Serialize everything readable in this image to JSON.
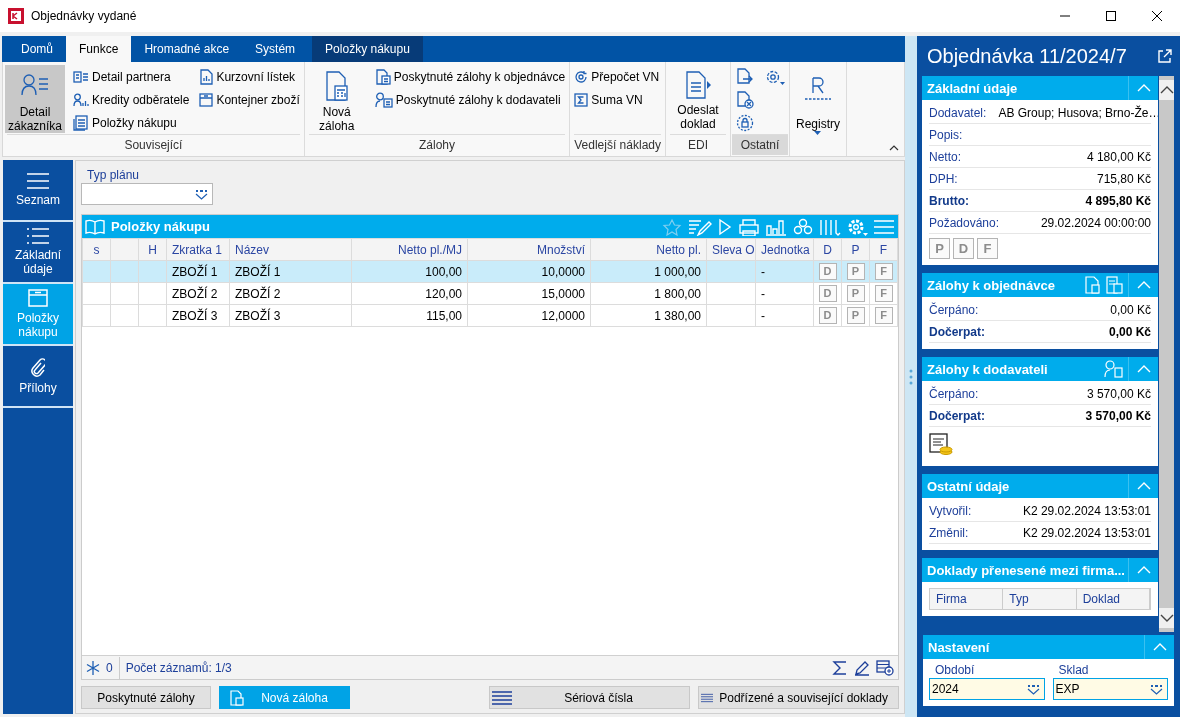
{
  "window": {
    "title": "Objednávky vydané"
  },
  "ribbon": {
    "tabs": [
      {
        "label": "Domů",
        "selected": false,
        "kind": "normal"
      },
      {
        "label": "Funkce",
        "selected": true,
        "kind": "normal"
      },
      {
        "label": "Hromadné akce",
        "selected": false,
        "kind": "normal"
      },
      {
        "label": "Systém",
        "selected": false,
        "kind": "normal"
      },
      {
        "label": "Položky nákupu",
        "selected": false,
        "kind": "contextual"
      }
    ],
    "groups": [
      {
        "label": "Související",
        "highlighted": false,
        "items": [
          {
            "kind": "large",
            "label": "Detail zákazníka",
            "selected": true
          },
          {
            "kind": "small",
            "label": "Detail partnera",
            "selected": false
          },
          {
            "kind": "small",
            "label": "Kredity odběratele",
            "selected": false
          },
          {
            "kind": "small",
            "label": "Položky nákupu",
            "selected": false
          },
          {
            "kind": "small",
            "label": "Kurzovní lístek",
            "selected": false
          },
          {
            "kind": "small",
            "label": "Kontejner zboží",
            "selected": false
          }
        ]
      },
      {
        "label": "Zálohy",
        "highlighted": false,
        "items": [
          {
            "kind": "large",
            "label": "Nová záloha",
            "selected": false
          },
          {
            "kind": "small",
            "label": "Poskytnuté zálohy k objednávce",
            "selected": false
          },
          {
            "kind": "small",
            "label": "Poskytnuté zálohy k dodavateli",
            "selected": false
          }
        ]
      },
      {
        "label": "Vedlejší náklady",
        "highlighted": false,
        "items": [
          {
            "kind": "small",
            "label": "Přepočet VN",
            "selected": false
          },
          {
            "kind": "small",
            "label": "Suma VN",
            "selected": false
          }
        ]
      },
      {
        "label": "EDI",
        "highlighted": false,
        "items": [
          {
            "kind": "large",
            "label": "Odeslat doklad",
            "selected": false
          }
        ]
      },
      {
        "label": "Ostatní",
        "highlighted": true,
        "items": [
          {
            "kind": "icon",
            "selected": false
          },
          {
            "kind": "icon",
            "selected": false
          },
          {
            "kind": "icon",
            "selected": false
          },
          {
            "kind": "icon",
            "selected": false
          }
        ]
      },
      {
        "highlighted": false,
        "items": [
          {
            "kind": "menu",
            "label": "Registry",
            "selected": false
          }
        ]
      }
    ]
  },
  "nav": [
    {
      "label": "Seznam",
      "selected": false
    },
    {
      "label": "Základní údaje",
      "selected": false
    },
    {
      "label": "Položky nákupu",
      "selected": true
    },
    {
      "label": "Přílohy",
      "selected": false
    }
  ],
  "filter": {
    "label": "Typ plánu"
  },
  "grid": {
    "title": "Položky nákupu",
    "columns": [
      {
        "label": "s",
        "kind": "center"
      },
      {
        "kind": "text"
      },
      {
        "label": "H",
        "kind": "center"
      },
      {
        "label": "Zkratka 1",
        "kind": "text"
      },
      {
        "label": "Název",
        "kind": "text"
      },
      {
        "label": "Netto pl./MJ",
        "kind": "number"
      },
      {
        "label": "Množství",
        "kind": "number"
      },
      {
        "label": "Netto pl.",
        "kind": "number"
      },
      {
        "label": "Sleva O",
        "kind": "text"
      },
      {
        "label": "Jednotka",
        "kind": "text"
      },
      {
        "label": "D",
        "kind": "flag"
      },
      {
        "label": "P",
        "kind": "flag"
      },
      {
        "label": "F",
        "kind": "flag"
      }
    ],
    "rows": [
      {
        "selected": true,
        "cells": [
          null,
          null,
          null,
          "ZBOŽÍ 1",
          "ZBOŽÍ 1",
          "100,00",
          "10,0000",
          "1 000,00",
          null,
          "-",
          "D",
          "P",
          "F"
        ]
      },
      {
        "selected": false,
        "cells": [
          null,
          null,
          null,
          "ZBOŽÍ 2",
          "ZBOŽÍ 2",
          "120,00",
          "15,0000",
          "1 800,00",
          null,
          "-",
          "D",
          "P",
          "F"
        ]
      },
      {
        "selected": false,
        "cells": [
          null,
          null,
          null,
          "ZBOŽÍ 3",
          "ZBOŽÍ 3",
          "115,00",
          "12,0000",
          "1 380,00",
          null,
          "-",
          "D",
          "P",
          "F"
        ]
      }
    ],
    "footer": {
      "filter_count": "0",
      "record_count": "Počet záznamů: 1/3"
    }
  },
  "actions": {
    "left": [
      {
        "label": "Poskytnuté zálohy",
        "kind": "plain"
      },
      {
        "label": "Nová záloha",
        "kind": "primary"
      }
    ],
    "right": [
      {
        "label": "Sériová čísla",
        "kind": "list"
      },
      {
        "label": "Podřízené a související doklady",
        "kind": "list"
      }
    ]
  },
  "detail": {
    "title": "Objednávka 11/2024/7",
    "sections": [
      {
        "kind": "fields",
        "title": "Základní údaje",
        "expanded": true,
        "rows": [
          {
            "label": "Dodavatel:",
            "value": "AB Group; Husova; Brno-Že…",
            "bold": false,
            "kind": "inline"
          },
          {
            "label": "Popis:",
            "bold": false,
            "kind": "inline"
          },
          {
            "label": "Netto:",
            "value": "4 180,00 Kč",
            "bold": false,
            "kind": "amount"
          },
          {
            "label": "DPH:",
            "value": "715,80 Kč",
            "bold": false,
            "kind": "amount"
          },
          {
            "label": "Brutto:",
            "value": "4 895,80 Kč",
            "bold": true,
            "kind": "amount"
          },
          {
            "label": "Požadováno:",
            "value": "29.02.2024 00:00:00",
            "bold": false,
            "kind": "amount"
          }
        ],
        "flags": [
          "P",
          "D",
          "F"
        ]
      },
      {
        "kind": "fields",
        "title": "Zálohy k objednávce",
        "expanded": true,
        "rows": [
          {
            "label": "Čerpáno:",
            "value": "0,00 Kč",
            "bold": false,
            "kind": "amount"
          },
          {
            "label": "Dočerpat:",
            "value": "0,00 Kč",
            "bold": true,
            "kind": "amount"
          }
        ]
      },
      {
        "kind": "fields",
        "title": "Zálohy k dodavateli",
        "expanded": true,
        "rows": [
          {
            "label": "Čerpáno:",
            "value": "3 570,00 Kč",
            "bold": false,
            "kind": "amount"
          },
          {
            "label": "Dočerpat:",
            "value": "3 570,00 Kč",
            "bold": true,
            "kind": "amount"
          }
        ]
      },
      {
        "kind": "fields",
        "title": "Ostatní údaje",
        "expanded": true,
        "rows": [
          {
            "label": "Vytvořil:",
            "value": "K2 29.02.2024 13:53:01",
            "bold": false,
            "kind": "amount"
          },
          {
            "label": "Změnil:",
            "value": "K2 29.02.2024 13:53:01",
            "bold": false,
            "kind": "amount"
          }
        ]
      },
      {
        "kind": "table",
        "title": "Doklady přenesené mezi firma...",
        "expanded": true,
        "columns": [
          "Firma",
          "Typ",
          "Doklad"
        ]
      }
    ],
    "settings": {
      "title": "Nastavení",
      "expanded": true,
      "fields": [
        {
          "label": "Období",
          "value": "2024"
        },
        {
          "label": "Sklad",
          "value": "EXP"
        }
      ]
    }
  }
}
